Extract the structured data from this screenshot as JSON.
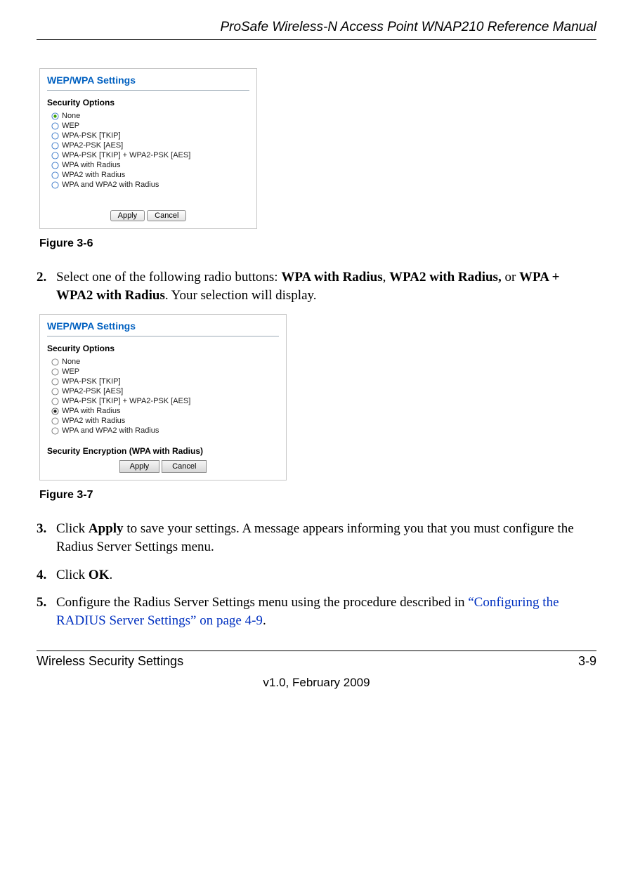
{
  "header": {
    "running_title": "ProSafe Wireless-N Access Point WNAP210 Reference Manual"
  },
  "figure1": {
    "panel_title": "WEP/WPA Settings",
    "group_label": "Security Options",
    "selected_index": 0,
    "options": [
      "None",
      "WEP",
      "WPA-PSK [TKIP]",
      "WPA2-PSK [AES]",
      "WPA-PSK [TKIP] + WPA2-PSK [AES]",
      "WPA with Radius",
      "WPA2 with Radius",
      "WPA and WPA2 with Radius"
    ],
    "apply_label": "Apply",
    "cancel_label": "Cancel",
    "caption": "Figure 3-6"
  },
  "step2": {
    "num": "2.",
    "text_before_bold": "Select one of the following radio buttons: ",
    "b1": "WPA with Radius",
    "sep1": ", ",
    "b2": "WPA2 with Radius,",
    "sep2": " or ",
    "b3": "WPA + WPA2 with Radius",
    "tail": ". Your selection will display."
  },
  "figure2": {
    "panel_title": "WEP/WPA Settings",
    "group_label": "Security Options",
    "selected_index": 5,
    "options": [
      "None",
      "WEP",
      "WPA-PSK [TKIP]",
      "WPA2-PSK [AES]",
      "WPA-PSK [TKIP] + WPA2-PSK [AES]",
      "WPA with Radius",
      "WPA2 with Radius",
      "WPA and WPA2 with Radius"
    ],
    "encryption_label": "Security Encryption (WPA with Radius)",
    "apply_label": "Apply",
    "cancel_label": "Cancel",
    "caption": "Figure 3-7"
  },
  "step3": {
    "num": "3.",
    "pre": "Click ",
    "b": "Apply",
    "post": " to save your settings. A message appears informing you that you must configure the Radius Server Settings menu."
  },
  "step4": {
    "num": "4.",
    "pre": "Click ",
    "b": "OK",
    "post": "."
  },
  "step5": {
    "num": "5.",
    "pre": "Configure the Radius Server Settings menu using the procedure described in ",
    "link": "“Configuring the RADIUS Server Settings” on page 4-9",
    "post": "."
  },
  "footer": {
    "left": "Wireless Security Settings",
    "right": "3-9",
    "center": "v1.0, February 2009"
  }
}
